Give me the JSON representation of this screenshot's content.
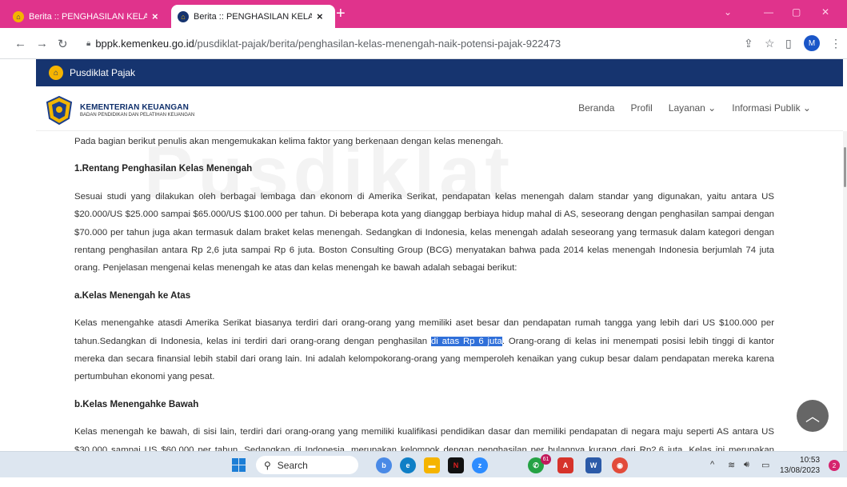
{
  "browser": {
    "tabs": [
      {
        "title": "Berita :: PENGHASILAN KELAS MI",
        "active": false
      },
      {
        "title": "Berita :: PENGHASILAN KELAS MI",
        "active": true
      }
    ],
    "new_tab_label": "+",
    "url_domain": "bppk.kemenkeu.go.id",
    "url_path": "/pusdiklat-pajak/berita/penghasilan-kelas-menengah-naik-potensi-pajak-922473",
    "profile_initial": "M"
  },
  "site": {
    "topbar_title": "Pusdiklat Pajak",
    "ministry_name": "KEMENTERIAN KEUANGAN",
    "ministry_sub": "BADAN PENDIDIKAN DAN PELATIHAN KEUANGAN",
    "nav": [
      "Beranda",
      "Profil",
      "Layanan ⌄",
      "Informasi Publik ⌄"
    ],
    "watermark": "Pusdiklat"
  },
  "article": {
    "intro": "Pada bagian berikut penulis akan mengemukakan kelima faktor yang berkenaan dengan kelas menengah.",
    "h1": "1.Rentang Penghasilan Kelas Menengah",
    "p1": "Sesuai studi yang dilakukan oleh berbagai lembaga dan ekonom di Amerika Serikat, pendapatan kelas menengah dalam standar yang digunakan, yaitu antara US $20.000/US $25.000 sampai $65.000/US $100.000 per tahun. Di beberapa kota yang dianggap berbiaya hidup mahal di AS, seseorang dengan penghasilan sampai dengan $70.000 per tahun juga akan termasuk dalam braket kelas menengah. Sedangkan di Indonesia, kelas menengah adalah seseorang yang termasuk dalam kategori dengan rentang penghasilan antara Rp 2,6 juta sampai Rp 6 juta. Boston Consulting Group (BCG) menyatakan bahwa pada 2014 kelas menengah Indonesia berjumlah 74 juta orang. Penjelasan mengenai kelas menengah ke atas dan kelas menengah ke bawah adalah sebagai berikut:",
    "h2": "a.Kelas Menengah ke Atas",
    "p2_before": "Kelas menengahke atasdi Amerika Serikat biasanya terdiri dari orang-orang yang memiliki aset besar dan pendapatan rumah tangga yang lebih dari US $100.000 per tahun.Sedangkan di Indonesia, kelas ini terdiri dari orang-orang dengan penghasilan ",
    "p2_highlight": "di atas Rp 6 juta",
    "p2_after": ". Orang-orang di kelas ini menempati posisi lebih tinggi di kantor mereka dan secara finansial lebih stabil dari orang lain. Ini adalah kelompokorang-orang yang memperoleh kenaikan yang cukup besar dalam pendapatan mereka karena pertumbuhan ekonomi yang pesat.",
    "h3": "b.Kelas Menengahke Bawah",
    "p3": "Kelas menengah ke bawah, di sisi lain, terdiri dari orang-orang yang memiliki kualifikasi pendidikan dasar dan memiliki pendapatan di negara maju seperti AS antara US $30.000 sampai US $60.000 per tahun. Sedangkan di Indonesia, merupakan kelompok dengan penghasilan per bulannya kurang dari Rp2.6 juta. Kelas ini merupakan bagian besar dari"
  },
  "taskbar": {
    "search_label": "Search",
    "chat_badge": "61",
    "time": "10:53",
    "date": "13/08/2023",
    "notification_count": "2"
  },
  "colors": {
    "tabstrip": "#e0338c",
    "site_topbar": "#16346f",
    "highlight": "#2f6fd9"
  }
}
